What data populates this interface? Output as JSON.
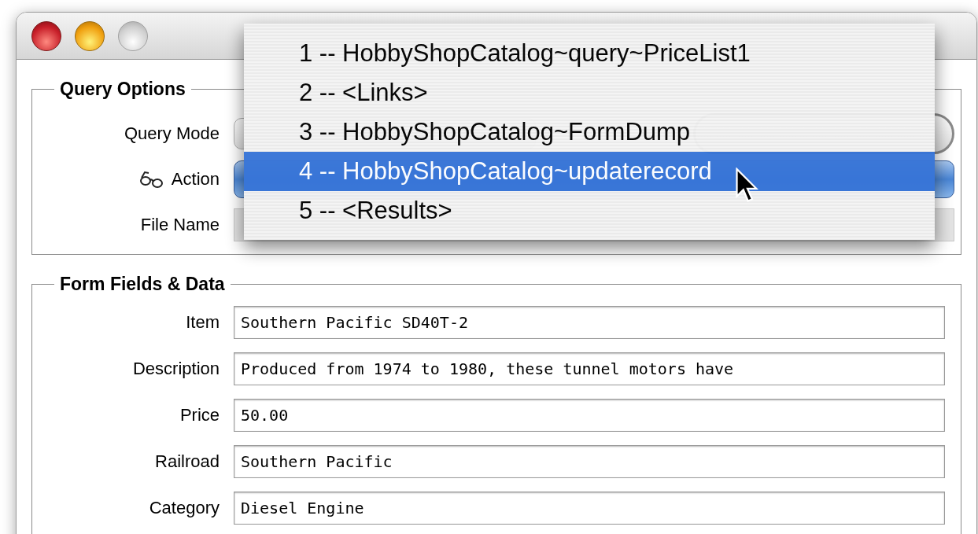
{
  "query_options": {
    "title": "Query Options",
    "rows": [
      {
        "label": "Query Mode",
        "kind": "mode"
      },
      {
        "label": "Action",
        "kind": "action"
      },
      {
        "label": "File Name",
        "kind": "file"
      }
    ]
  },
  "menu": {
    "items": [
      {
        "label": "1 -- HobbyShopCatalog~query~PriceList1",
        "selected": false
      },
      {
        "label": "2 -- <Links>",
        "selected": false
      },
      {
        "label": "3 -- HobbyShopCatalog~FormDump",
        "selected": false
      },
      {
        "label": "4 -- HobbyShopCatalog~updaterecord",
        "selected": true
      },
      {
        "label": "5 -- <Results>",
        "selected": false
      }
    ]
  },
  "form_fields": {
    "title": "Form Fields & Data",
    "fields": [
      {
        "label": "Item",
        "value": "Southern Pacific SD40T-2"
      },
      {
        "label": "Description",
        "value": "Produced from 1974 to 1980, these tunnel motors have"
      },
      {
        "label": "Price",
        "value": "50.00"
      },
      {
        "label": "Railroad",
        "value": "Southern Pacific"
      },
      {
        "label": "Category",
        "value": "Diesel Engine"
      }
    ]
  }
}
